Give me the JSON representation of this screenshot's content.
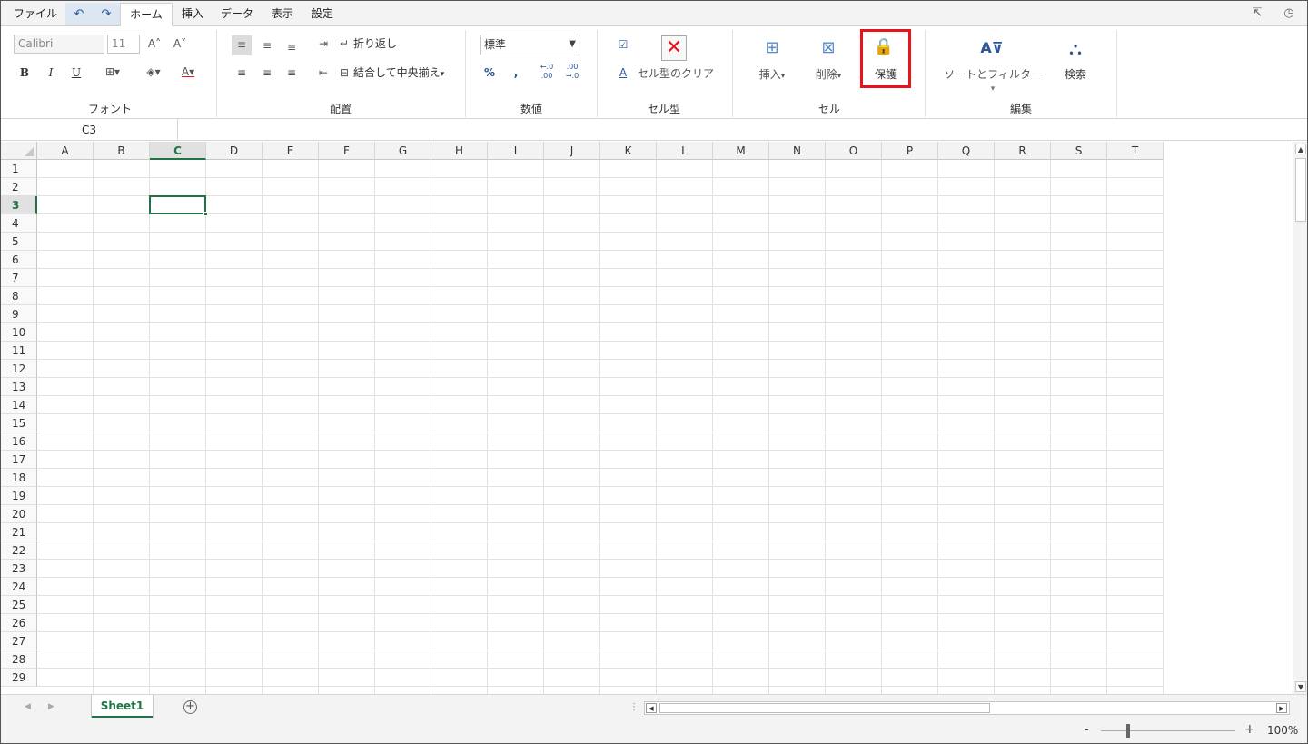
{
  "tabs": {
    "file": "ファイル",
    "home": "ホーム",
    "insert": "挿入",
    "data": "データ",
    "view": "表示",
    "settings": "設定"
  },
  "quick_access": {
    "undo_icon": "undo-icon",
    "redo_icon": "redo-icon"
  },
  "ribbon": {
    "font": {
      "label": "フォント",
      "font_name": "Calibri",
      "font_size": "11",
      "bold": "B",
      "italic": "I",
      "underline": "U"
    },
    "alignment": {
      "label": "配置",
      "wrap_text": "折り返し",
      "merge_center": "結合して中央揃え"
    },
    "number": {
      "label": "数値",
      "format": "標準",
      "percent": "%",
      "comma": ",",
      "inc_decimal": "←.0 .00",
      "dec_decimal": ".00 →.0"
    },
    "cell_style": {
      "label": "セル型",
      "clear_cell_style": "セル型のクリア"
    },
    "cells": {
      "label": "セル",
      "insert": "挿入",
      "delete": "削除",
      "protect": "保護"
    },
    "editing": {
      "label": "編集",
      "sort_filter": "ソートとフィルター",
      "find": "検索"
    }
  },
  "formula_bar": {
    "name_box": "C3",
    "formula": ""
  },
  "grid": {
    "columns": [
      "A",
      "B",
      "C",
      "D",
      "E",
      "F",
      "G",
      "H",
      "I",
      "J",
      "K",
      "L",
      "M",
      "N",
      "O",
      "P",
      "Q",
      "R",
      "S",
      "T"
    ],
    "rows": [
      "1",
      "2",
      "3",
      "4",
      "5",
      "6",
      "7",
      "8",
      "9",
      "10",
      "11",
      "12",
      "13",
      "14",
      "15",
      "16",
      "17",
      "18",
      "19",
      "20",
      "21",
      "22",
      "23",
      "24",
      "25",
      "26",
      "27",
      "28",
      "29"
    ],
    "selected_cell": "C3"
  },
  "sheets": {
    "active": "Sheet1"
  },
  "status": {
    "zoom_minus": "-",
    "zoom_plus": "+",
    "zoom": "100%"
  },
  "colors": {
    "accent": "#217346",
    "highlight": "#e8121b"
  }
}
